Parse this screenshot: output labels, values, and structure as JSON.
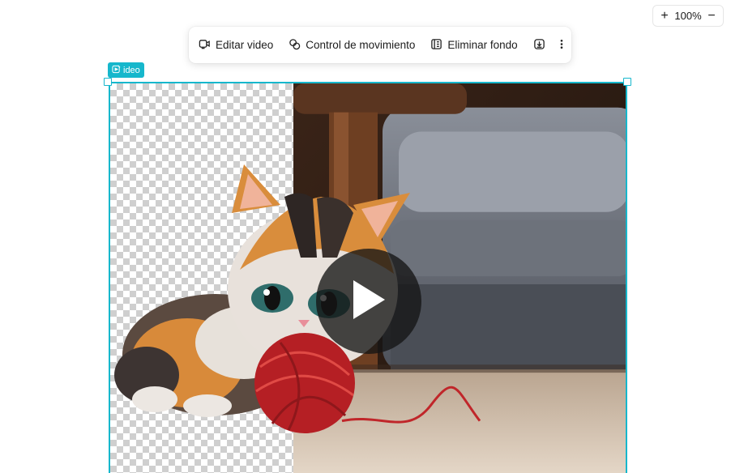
{
  "zoom": {
    "plus": "+",
    "value": "100%",
    "minus": "−"
  },
  "toolbar": {
    "edit_video": "Editar video",
    "motion_control": "Control de movimiento",
    "remove_bg": "Eliminar fondo"
  },
  "tag": {
    "label": "ideo"
  },
  "colors": {
    "accent": "#16b7cc"
  },
  "icons": {
    "edit": "edit-video-icon",
    "motion": "motion-control-icon",
    "remove_bg": "remove-background-icon",
    "download": "download-icon",
    "more": "more-vertical-icon",
    "play": "play-icon"
  }
}
